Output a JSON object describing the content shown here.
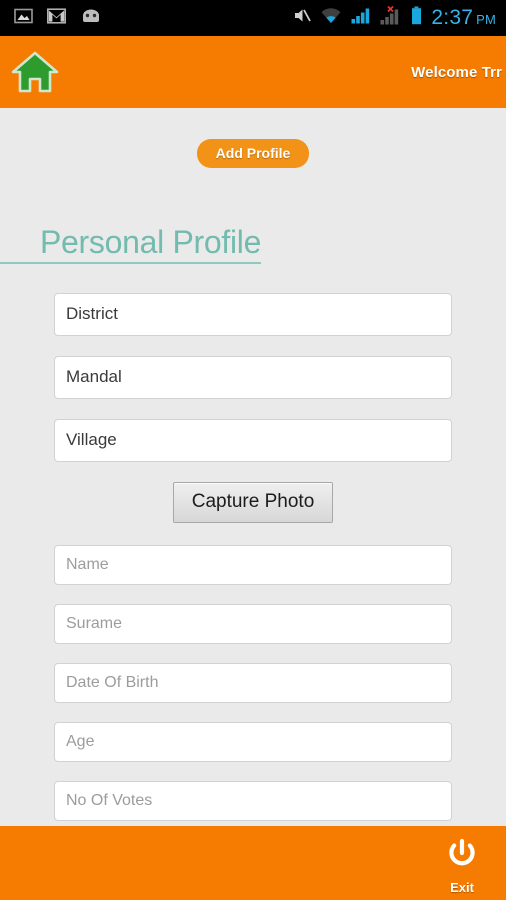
{
  "status_bar": {
    "time": "2:37",
    "am_pm": "PM",
    "time_color": "#35b3e8",
    "background": "#000000",
    "left_icons": [
      "image-icon",
      "gmail-icon",
      "android-robot-icon"
    ],
    "right_icons": [
      "mute-icon",
      "wifi-icon",
      "signal-bars-icon",
      "signal-bars-no-service-icon",
      "battery-icon"
    ]
  },
  "header": {
    "background": "#f57c00",
    "home_icon": "home-icon",
    "home_icon_color": "#2e9b2e",
    "welcome_text": "Welcome Trr"
  },
  "toolbar": {
    "add_profile_label": "Add Profile",
    "add_profile_color": "#f29318"
  },
  "main": {
    "section_title": "Personal Profile",
    "section_title_color": "#72bbae",
    "capture_photo_label": "Capture Photo",
    "filled_fields": [
      {
        "name": "district",
        "value": "District"
      },
      {
        "name": "mandal",
        "value": "Mandal"
      },
      {
        "name": "village",
        "value": "Village"
      }
    ],
    "placeholder_fields": [
      {
        "name": "name",
        "placeholder": "Name"
      },
      {
        "name": "surname",
        "placeholder": "Surame"
      },
      {
        "name": "date-of-birth",
        "placeholder": "Date Of Birth"
      },
      {
        "name": "age",
        "placeholder": "Age"
      },
      {
        "name": "no-of-votes",
        "placeholder": "No Of Votes"
      }
    ]
  },
  "footer": {
    "background": "#f57c00",
    "exit_label": "Exit",
    "exit_icon": "power-icon"
  }
}
